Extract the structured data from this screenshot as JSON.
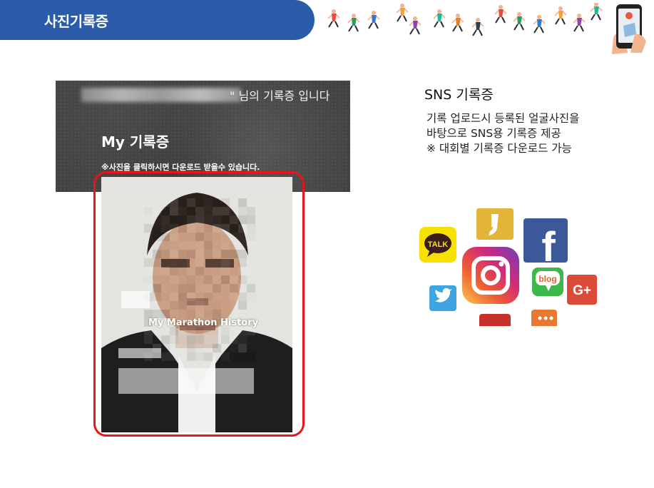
{
  "header": {
    "title": "사진기록증"
  },
  "card": {
    "greeting": "\" 님의 기록증 입니다",
    "section_title": "My 기록증",
    "click_note": "※사진을 클릭하시면 다운로드 받을수 있습니다."
  },
  "photo": {
    "caption": "My Marathon History"
  },
  "sns": {
    "title": "SNS 기록증",
    "desc_lines": [
      "기록 업로드시 등록된 얼굴사진을",
      "바탕으로 SNS용 기록증 제공",
      "※ 대회별 기록증 다운로드 가능"
    ],
    "icons": {
      "kakaotalk": "TALK",
      "blog": "blog",
      "google_plus": "G+",
      "facebook": "f"
    }
  },
  "colors": {
    "header_blue": "#2a5caa",
    "frame_red": "#e8151b",
    "kakao_yellow": "#f7e100",
    "facebook_blue": "#3b5998",
    "twitter_blue": "#3fa5e0",
    "blog_green": "#3db94b",
    "gplus_red": "#dc4a38"
  }
}
